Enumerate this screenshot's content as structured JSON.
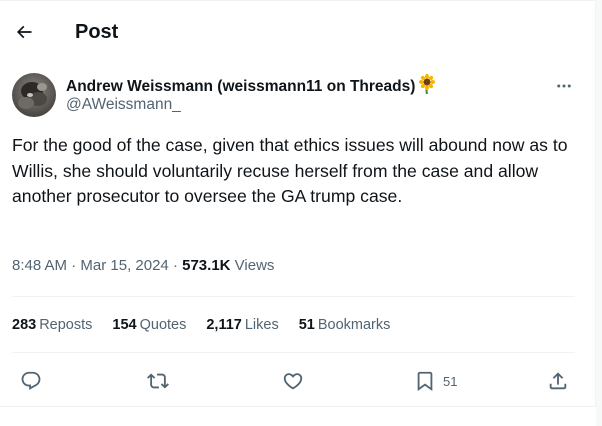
{
  "header": {
    "title": "Post",
    "back_icon": "arrow-left-icon"
  },
  "author": {
    "name": "Andrew Weissmann (weissmann11 on Threads)",
    "emoji": "sunflower-icon",
    "handle": "@AWeissmann_"
  },
  "tweet": {
    "text": "For the good of the case, given that ethics issues will abound now as to Willis, she should voluntarily recuse herself from the case and allow another prosecutor to oversee the GA trump case."
  },
  "meta": {
    "time": "8:48 AM",
    "separator": "·",
    "date": "Mar 15, 2024",
    "views_count": "573.1K",
    "views_label": "Views"
  },
  "stats": {
    "reposts": {
      "count": "283",
      "label": "Reposts"
    },
    "quotes": {
      "count": "154",
      "label": "Quotes"
    },
    "likes": {
      "count": "2,117",
      "label": "Likes"
    },
    "bookmarks": {
      "count": "51",
      "label": "Bookmarks"
    }
  },
  "actions": {
    "bookmark_count": "51",
    "icons": [
      "reply-icon",
      "repost-icon",
      "like-icon",
      "bookmark-icon",
      "share-icon"
    ]
  },
  "colors": {
    "text_primary": "#0f1419",
    "text_secondary": "#536471",
    "divider": "#eff3f4"
  }
}
